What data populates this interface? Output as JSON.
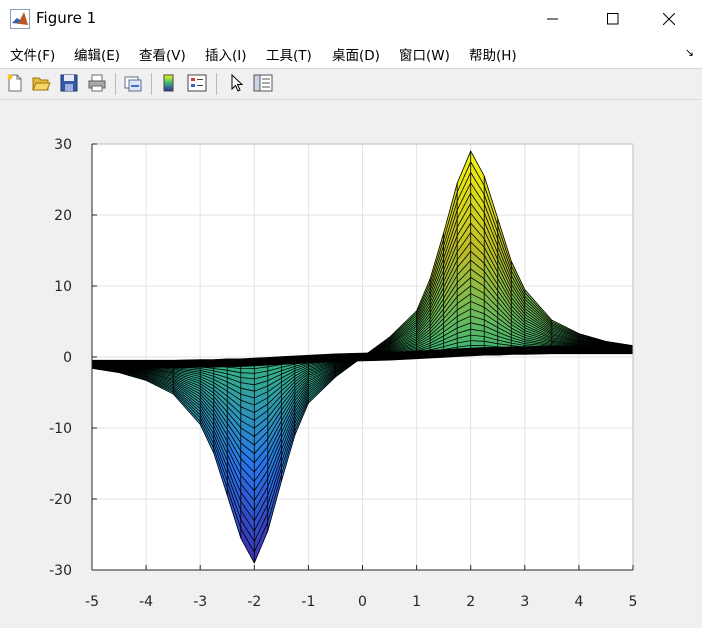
{
  "window": {
    "title": "Figure 1",
    "minimize_glyph": "—",
    "maximize_glyph": "☐",
    "close_glyph": "✕"
  },
  "menu": {
    "items": [
      "文件(F)",
      "编辑(E)",
      "查看(V)",
      "插入(I)",
      "工具(T)",
      "桌面(D)",
      "窗口(W)",
      "帮助(H)"
    ],
    "dock_glyph": "↘"
  },
  "toolbar": {
    "icons": [
      "new-figure-icon",
      "open-file-icon",
      "save-icon",
      "print-icon",
      "link-plot-icon",
      "insert-colorbar-icon",
      "insert-legend-icon",
      "edit-plot-icon",
      "property-inspector-icon"
    ]
  },
  "colors": {
    "surface_low": "#3e26a8",
    "surface_mid": "#35b779",
    "surface_high": "#f9fb0e",
    "mesh": "#000000",
    "axes_bg": "#ffffff",
    "grid": "#e3e3e3"
  },
  "chart_data": {
    "type": "surface",
    "view": "2-D side view (looking along y)",
    "x_ticks": [
      "-5",
      "-4",
      "-3",
      "-2",
      "-1",
      "0",
      "1",
      "2",
      "3",
      "4",
      "5"
    ],
    "y_ticks": [
      "30",
      "20",
      "10",
      "0",
      "-10",
      "-20",
      "-30"
    ],
    "xlim": [
      -5,
      5
    ],
    "ylim": [
      -30,
      30
    ],
    "grid": true,
    "colormap": "parula",
    "title": "",
    "xlabel": "",
    "ylabel": "",
    "peak": {
      "x": 2,
      "z": 29
    },
    "trough": {
      "x": -2,
      "z": -29
    },
    "surface_curves": {
      "x": [
        -5,
        -4.5,
        -4,
        -3.5,
        -3,
        -2.75,
        -2.5,
        -2.25,
        -2,
        -1.75,
        -1.5,
        -1.25,
        -1,
        -0.5,
        0,
        0.5,
        1,
        1.25,
        1.5,
        1.75,
        2,
        2.25,
        2.5,
        2.75,
        3,
        3.5,
        4,
        4.5,
        5
      ],
      "outer_envelope_z": [
        -1.6,
        -2.2,
        -3.3,
        -5.2,
        -9.5,
        -13.5,
        -19.5,
        -25.5,
        -29,
        -24.5,
        -17.5,
        -11,
        -6.5,
        -2.8,
        0,
        2.8,
        6.5,
        11,
        17.5,
        24.5,
        29,
        25.5,
        19.5,
        13.5,
        9.5,
        5.2,
        3.3,
        2.2,
        1.6
      ],
      "inner_envelope_z": [
        -1.0,
        -1.0,
        -1.0,
        -1.0,
        -0.9,
        -0.9,
        -0.8,
        -0.8,
        -0.7,
        -0.6,
        -0.5,
        -0.4,
        -0.3,
        -0.1,
        0,
        0.1,
        0.3,
        0.4,
        0.5,
        0.6,
        0.7,
        0.8,
        0.8,
        0.9,
        0.9,
        1.0,
        1.0,
        1.0,
        1.0
      ]
    }
  }
}
